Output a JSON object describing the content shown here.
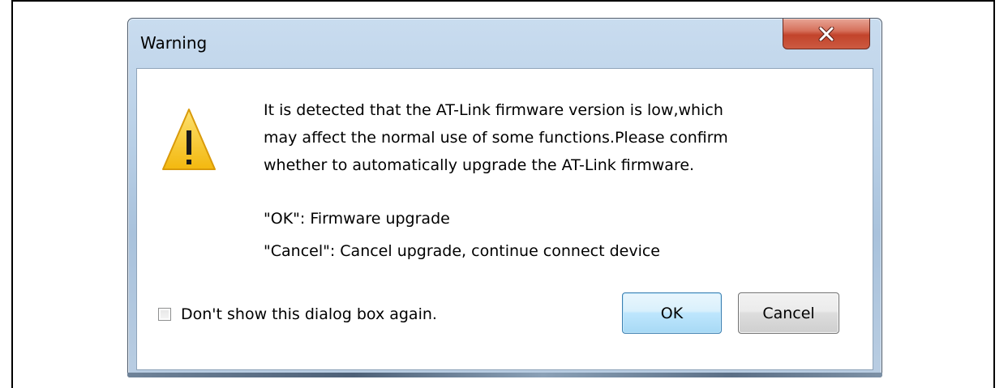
{
  "dialog": {
    "title": "Warning",
    "close_glyph": "x",
    "icon": "warning-triangle-icon",
    "message_lines": [
      "It is detected that the AT-Link firmware version is low,which",
      "may affect the normal use of some functions.Please confirm",
      "whether to automatically upgrade the AT-Link firmware."
    ],
    "options": {
      "ok": "\"OK\":  Firmware upgrade",
      "cancel": "\"Cancel\":  Cancel upgrade, continue connect device"
    },
    "checkbox_label": "Don't show this dialog box again.",
    "checkbox_checked": false,
    "ok_label": "OK",
    "cancel_label": "Cancel"
  },
  "colors": {
    "close_button": "#c7452d",
    "warning_fill": "#f7c21f",
    "ok_border": "#3c7fb1"
  }
}
